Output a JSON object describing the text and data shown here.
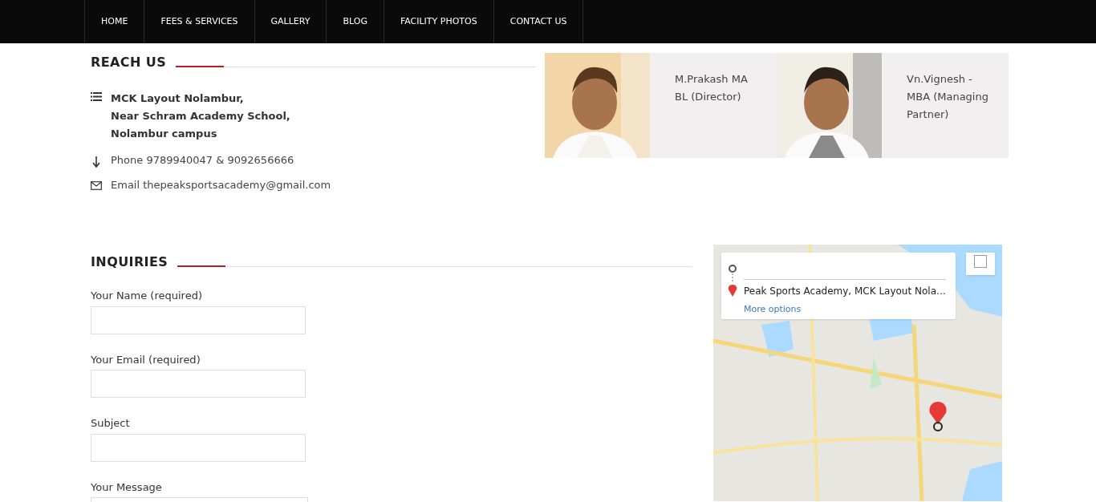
{
  "nav": [
    {
      "label": "HOME"
    },
    {
      "label": "FEES & SERVICES"
    },
    {
      "label": "GALLERY"
    },
    {
      "label": "BLOG"
    },
    {
      "label": "FACILITY PHOTOS"
    },
    {
      "label": "CONTACT US"
    }
  ],
  "reach_us": {
    "title": "REACH US",
    "items": [
      {
        "kind": "address",
        "lines": [
          "MCK Layout Nolambur,",
          "Near Schram Academy School,",
          "Nolambur campus"
        ]
      },
      {
        "kind": "phone",
        "lines": [
          "Phone 9789940047 & 9092656666"
        ]
      },
      {
        "kind": "email",
        "lines": [
          "Email thepeaksportsacademy@gmail.com"
        ]
      }
    ]
  },
  "people": [
    {
      "name": "M.Prakash MA BL (Director)",
      "kind": "picture"
    },
    {
      "name": "Vn.Vignesh - MBA (Managing Partner)",
      "kind": "picture"
    }
  ],
  "inquiries": {
    "title": "INQUIRIES",
    "fields": [
      {
        "label": "Your Name (required)"
      },
      {
        "label": "Your Email (required)"
      },
      {
        "label": "Subject"
      },
      {
        "label": "Your Message",
        "kind": "textarea"
      }
    ]
  },
  "map": {
    "kind": "picture",
    "destination": "Peak Sports Academy, MCK Layout Nola…",
    "link": "More options"
  }
}
